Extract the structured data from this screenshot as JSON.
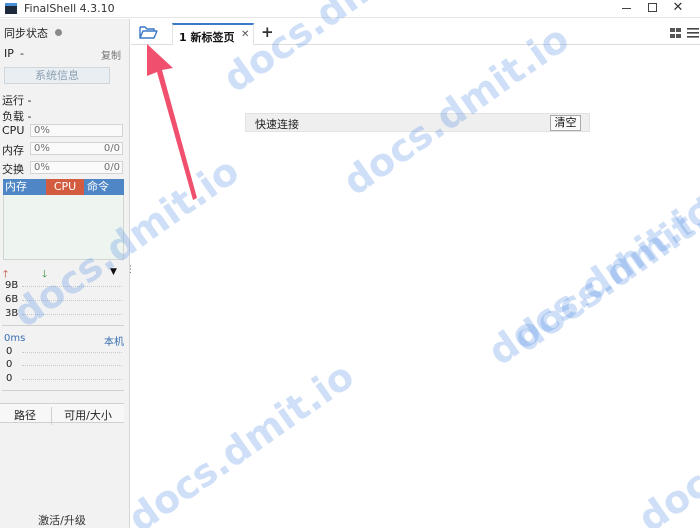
{
  "window": {
    "title": "FinalShell 4.3.10",
    "minimize_glyph": "",
    "close_glyph": "✕"
  },
  "sidebar": {
    "sync_status_label": "同步状态",
    "ip_label": "IP",
    "ip_value": "-",
    "copy_label": "复制",
    "sysinfo_button": "系统信息",
    "run_label": "运行 -",
    "load_label": "负载 -",
    "cpu": {
      "label": "CPU",
      "value": "0%",
      "extra": ""
    },
    "memory": {
      "label": "内存",
      "value": "0%",
      "extra": "0/0"
    },
    "swap": {
      "label": "交换",
      "value": "0%",
      "extra": "0/0"
    },
    "process_tabs": [
      "内存",
      "CPU",
      "命令"
    ],
    "network": {
      "up_glyph": "🡑",
      "down_glyph": "🡓",
      "dropdown_glyph": "▼",
      "more_glyph": "⋮",
      "levels": [
        "9B",
        "6B",
        "3B"
      ]
    },
    "latency": {
      "label": "0ms",
      "host_link": "本机",
      "values": [
        "0",
        "0",
        "0"
      ]
    },
    "disk": {
      "col_path": "路径",
      "col_size": "可用/大小"
    },
    "activate_link": "激活/升级"
  },
  "tabs": {
    "items": [
      {
        "label": "1 新标签页",
        "close_glyph": "✕",
        "active": true
      }
    ],
    "add_glyph": "+"
  },
  "quick_connect": {
    "label": "快速连接",
    "clear_button": "清空"
  },
  "watermark": {
    "text": "docs.dmit.io"
  },
  "colors": {
    "accent": "#3c78c8",
    "process_tab_bg": "#4f86c6",
    "cpu_tab_bg": "#d35b3f",
    "arrow": "#f0506e",
    "folder_icon": "#3a78c6"
  }
}
